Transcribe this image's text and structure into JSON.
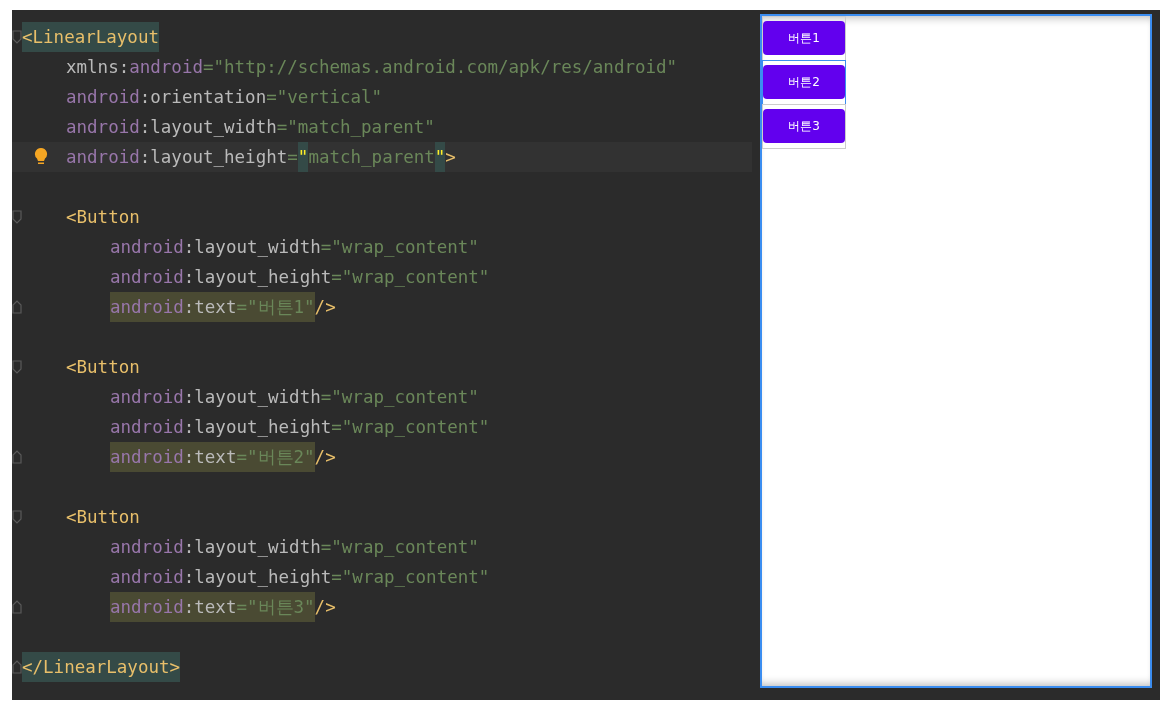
{
  "editor": {
    "lines": [
      {
        "kind": "root",
        "current": false,
        "fold_start": true,
        "fold_end": false,
        "tokens": [
          {
            "kind": "tag",
            "text": "<LinearLayout",
            "highlighted": true
          }
        ]
      },
      {
        "kind": "attr",
        "current": false,
        "fold_start": false,
        "fold_end": false,
        "tokens": [
          {
            "kind": "plain",
            "text": "xmlns:",
            "highlighted": false
          },
          {
            "kind": "ns",
            "text": "android",
            "highlighted": false
          },
          {
            "kind": "value",
            "text": "=\"http://schemas.android.com/apk/res/android\"",
            "highlighted": false
          }
        ]
      },
      {
        "kind": "attr",
        "current": false,
        "fold_start": false,
        "fold_end": false,
        "tokens": [
          {
            "kind": "ns",
            "text": "android",
            "highlighted": false
          },
          {
            "kind": "plain",
            "text": ":orientation",
            "highlighted": false
          },
          {
            "kind": "value",
            "text": "=\"vertical\"",
            "highlighted": false
          }
        ]
      },
      {
        "kind": "attr",
        "current": false,
        "fold_start": false,
        "fold_end": false,
        "tokens": [
          {
            "kind": "ns",
            "text": "android",
            "highlighted": false
          },
          {
            "kind": "plain",
            "text": ":layout_width",
            "highlighted": false
          },
          {
            "kind": "value",
            "text": "=\"match_parent\"",
            "highlighted": false
          }
        ]
      },
      {
        "kind": "attr",
        "current": true,
        "fold_start": false,
        "fold_end": false,
        "tokens": [
          {
            "kind": "ns",
            "text": "android",
            "highlighted": false
          },
          {
            "kind": "plain",
            "text": ":layout_height",
            "highlighted": false
          },
          {
            "kind": "value",
            "text": "=",
            "highlighted": false
          },
          {
            "kind": "match",
            "text": "\"",
            "highlighted": true
          },
          {
            "kind": "value",
            "text": "match_parent",
            "highlighted": false
          },
          {
            "kind": "match",
            "text": "\"",
            "highlighted": true
          },
          {
            "kind": "tag",
            "text": ">",
            "highlighted": false
          }
        ]
      },
      {
        "kind": "blank"
      },
      {
        "kind": "attr",
        "current": false,
        "fold_start": true,
        "fold_end": false,
        "tokens": [
          {
            "kind": "tag",
            "text": "<Button",
            "highlighted": false
          }
        ]
      },
      {
        "kind": "nested",
        "current": false,
        "fold_start": false,
        "fold_end": false,
        "tokens": [
          {
            "kind": "ns",
            "text": "android",
            "highlighted": false
          },
          {
            "kind": "plain",
            "text": ":layout_width",
            "highlighted": false
          },
          {
            "kind": "value",
            "text": "=\"wrap_content\"",
            "highlighted": false
          }
        ]
      },
      {
        "kind": "nested",
        "current": false,
        "fold_start": false,
        "fold_end": false,
        "tokens": [
          {
            "kind": "ns",
            "text": "android",
            "highlighted": false
          },
          {
            "kind": "plain",
            "text": ":layout_height",
            "highlighted": false
          },
          {
            "kind": "value",
            "text": "=\"wrap_content\"",
            "highlighted": false
          }
        ]
      },
      {
        "kind": "nested",
        "current": false,
        "fold_start": false,
        "fold_end": true,
        "tokens": [
          {
            "kind": "ns",
            "text": "android",
            "highlighted": true
          },
          {
            "kind": "plain",
            "text": ":text",
            "highlighted": true
          },
          {
            "kind": "value",
            "text": "=\"버튼1\"",
            "highlighted": true
          },
          {
            "kind": "tag",
            "text": "/>",
            "highlighted": false
          }
        ]
      },
      {
        "kind": "blank"
      },
      {
        "kind": "attr",
        "current": false,
        "fold_start": true,
        "fold_end": false,
        "tokens": [
          {
            "kind": "tag",
            "text": "<Button",
            "highlighted": false
          }
        ]
      },
      {
        "kind": "nested",
        "current": false,
        "fold_start": false,
        "fold_end": false,
        "tokens": [
          {
            "kind": "ns",
            "text": "android",
            "highlighted": false
          },
          {
            "kind": "plain",
            "text": ":layout_width",
            "highlighted": false
          },
          {
            "kind": "value",
            "text": "=\"wrap_content\"",
            "highlighted": false
          }
        ]
      },
      {
        "kind": "nested",
        "current": false,
        "fold_start": false,
        "fold_end": false,
        "tokens": [
          {
            "kind": "ns",
            "text": "android",
            "highlighted": false
          },
          {
            "kind": "plain",
            "text": ":layout_height",
            "highlighted": false
          },
          {
            "kind": "value",
            "text": "=\"wrap_content\"",
            "highlighted": false
          }
        ]
      },
      {
        "kind": "nested",
        "current": false,
        "fold_start": false,
        "fold_end": true,
        "tokens": [
          {
            "kind": "ns",
            "text": "android",
            "highlighted": true
          },
          {
            "kind": "plain",
            "text": ":text",
            "highlighted": true
          },
          {
            "kind": "value",
            "text": "=\"버튼2\"",
            "highlighted": true
          },
          {
            "kind": "tag",
            "text": "/>",
            "highlighted": false
          }
        ]
      },
      {
        "kind": "blank"
      },
      {
        "kind": "attr",
        "current": false,
        "fold_start": true,
        "fold_end": false,
        "tokens": [
          {
            "kind": "tag",
            "text": "<Button",
            "highlighted": false
          }
        ]
      },
      {
        "kind": "nested",
        "current": false,
        "fold_start": false,
        "fold_end": false,
        "tokens": [
          {
            "kind": "ns",
            "text": "android",
            "highlighted": false
          },
          {
            "kind": "plain",
            "text": ":layout_width",
            "highlighted": false
          },
          {
            "kind": "value",
            "text": "=\"wrap_content\"",
            "highlighted": false
          }
        ]
      },
      {
        "kind": "nested",
        "current": false,
        "fold_start": false,
        "fold_end": false,
        "tokens": [
          {
            "kind": "ns",
            "text": "android",
            "highlighted": false
          },
          {
            "kind": "plain",
            "text": ":layout_height",
            "highlighted": false
          },
          {
            "kind": "value",
            "text": "=\"wrap_content\"",
            "highlighted": false
          }
        ]
      },
      {
        "kind": "nested",
        "current": false,
        "fold_start": false,
        "fold_end": true,
        "tokens": [
          {
            "kind": "ns",
            "text": "android",
            "highlighted": true
          },
          {
            "kind": "plain",
            "text": ":text",
            "highlighted": true
          },
          {
            "kind": "value",
            "text": "=\"버튼3\"",
            "highlighted": true
          },
          {
            "kind": "tag",
            "text": "/>",
            "highlighted": false
          }
        ]
      },
      {
        "kind": "blank"
      },
      {
        "kind": "root",
        "current": false,
        "fold_start": false,
        "fold_end": true,
        "tokens": [
          {
            "kind": "tag",
            "text": "</LinearLayout>",
            "highlighted": true
          }
        ]
      }
    ]
  },
  "preview": {
    "buttons": [
      {
        "label": "버튼1",
        "selected": false
      },
      {
        "label": "버튼2",
        "selected": true
      },
      {
        "label": "버튼3",
        "selected": false
      }
    ]
  }
}
